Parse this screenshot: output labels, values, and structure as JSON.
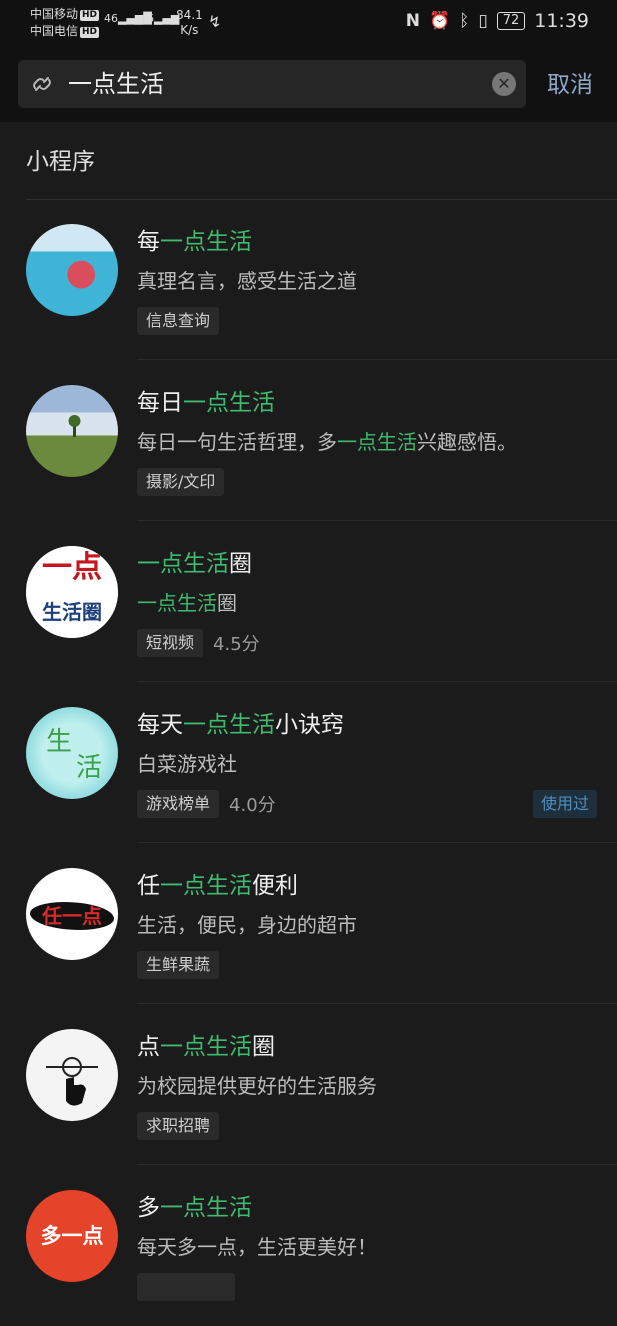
{
  "status_bar": {
    "carrier1": "中国移动",
    "carrier2": "中国电信",
    "hd": "HD",
    "net_label": "46",
    "speed_value": "84.1",
    "speed_unit": "K/s",
    "battery": "72",
    "time": "11:39"
  },
  "search": {
    "query": "一点生活",
    "cancel_label": "取消"
  },
  "section": {
    "title": "小程序"
  },
  "results": [
    {
      "title_pre": "每",
      "title_hl": "一点生活",
      "title_post": "",
      "desc_pre": "真理名言，感受生活之道",
      "desc_hl": "",
      "desc_post": "",
      "tag": "信息查询",
      "score": "",
      "used": ""
    },
    {
      "title_pre": "每日",
      "title_hl": "一点生活",
      "title_post": "",
      "desc_pre": "每日一句生活哲理，多",
      "desc_hl": "一点生活",
      "desc_post": "兴趣感悟。",
      "tag": "摄影/文印",
      "score": "",
      "used": ""
    },
    {
      "title_pre": "",
      "title_hl": "一点生活",
      "title_post": "圈",
      "desc_pre": "",
      "desc_hl": "一点生活",
      "desc_post": "圈",
      "tag": "短视频",
      "score": "4.5分",
      "used": "",
      "avatar_text_top": "一点",
      "avatar_text_bottom": "生活圈"
    },
    {
      "title_pre": "每天",
      "title_hl": "一点生活",
      "title_post": "小诀窍",
      "desc_pre": "白菜游戏社",
      "desc_hl": "",
      "desc_post": "",
      "tag": "游戏榜单",
      "score": "4.0分",
      "used": "使用过",
      "avatar_text_a": "生",
      "avatar_text_b": "活"
    },
    {
      "title_pre": "任",
      "title_hl": "一点生活",
      "title_post": "便利",
      "desc_pre": "生活，便民，身边的超市",
      "desc_hl": "",
      "desc_post": "",
      "tag": "生鲜果蔬",
      "score": "",
      "used": "",
      "avatar_text": "任一点"
    },
    {
      "title_pre": "点",
      "title_hl": "一点生活",
      "title_post": "圈",
      "desc_pre": "为校园提供更好的生活服务",
      "desc_hl": "",
      "desc_post": "",
      "tag": "求职招聘",
      "score": "",
      "used": ""
    },
    {
      "title_pre": "多",
      "title_hl": "一点生活",
      "title_post": "",
      "desc_pre": "每天多一点，生活更美好！",
      "desc_hl": "",
      "desc_post": "",
      "tag": "",
      "score": "",
      "used": "",
      "avatar_text": "多一点"
    }
  ]
}
